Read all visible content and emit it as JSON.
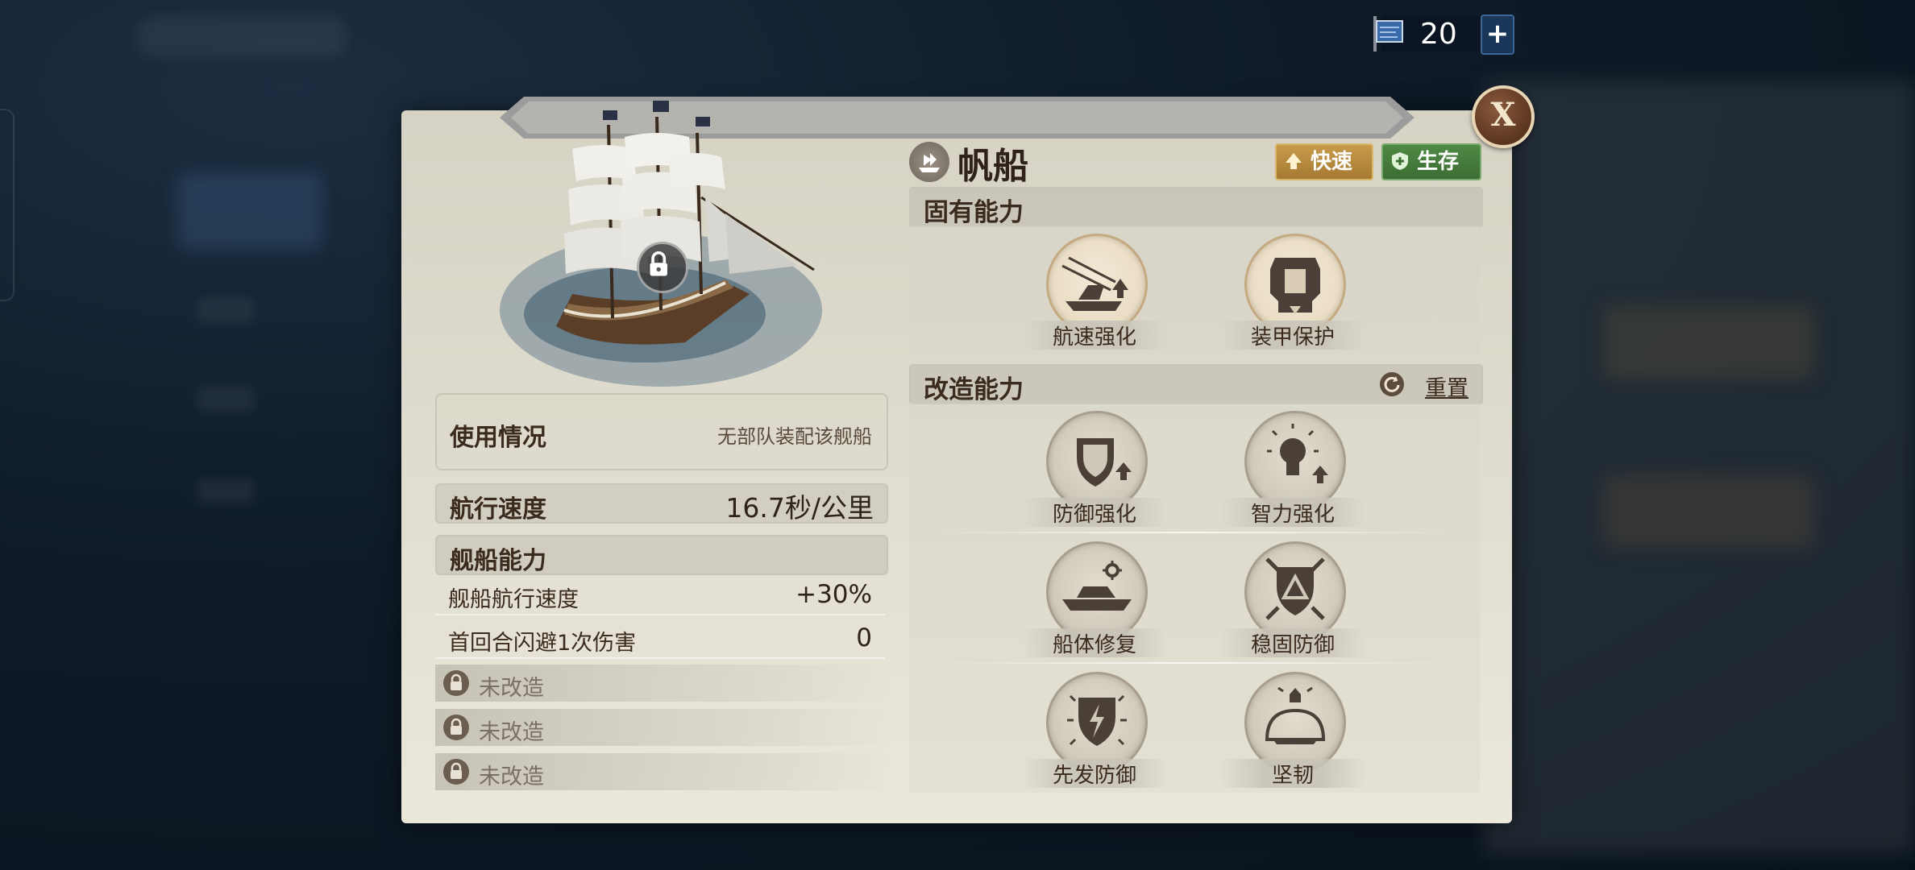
{
  "currency": {
    "value": "20",
    "plus_label": "+"
  },
  "close_label": "X",
  "ship": {
    "name": "帆船",
    "tags": {
      "fast": "快速",
      "survive": "生存"
    },
    "usage_label": "使用情况",
    "usage_value": "无部队装配该舰船",
    "speed_label": "航行速度",
    "speed_value": "16.7秒/公里",
    "abilities_title": "舰船能力",
    "stats": [
      {
        "label": "舰船航行速度",
        "value": "+30%"
      },
      {
        "label": "首回合闪避1次伤害",
        "value": "0"
      }
    ],
    "locked": [
      "未改造",
      "未改造",
      "未改造"
    ]
  },
  "innate": {
    "title": "固有能力",
    "skills": [
      "航速强化",
      "装甲保护"
    ]
  },
  "modify": {
    "title": "改造能力",
    "reset_label": "重置",
    "skills": [
      "防御强化",
      "智力强化",
      "船体修复",
      "稳固防御",
      "先发防御",
      "坚韧"
    ]
  },
  "colors": {
    "tag_fast": "#b8893d",
    "tag_survive": "#467d3c",
    "panel": "#e0ddd0",
    "text": "#3b2a1e"
  }
}
